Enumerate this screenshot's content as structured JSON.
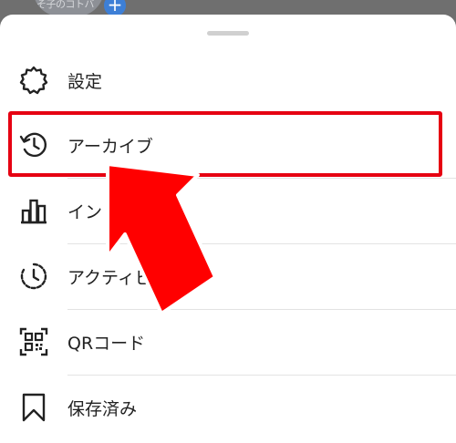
{
  "background": {
    "caption": "そ子のコトバ"
  },
  "menu": {
    "items": [
      {
        "label": "設定",
        "icon": "gear-icon"
      },
      {
        "label": "アーカイブ",
        "icon": "archive-history-icon"
      },
      {
        "label": "イン",
        "icon": "insights-bar-chart-icon"
      },
      {
        "label": "アクティビ",
        "icon": "activity-clock-icon"
      },
      {
        "label": "QRコード",
        "icon": "qr-code-icon"
      },
      {
        "label": "保存済み",
        "icon": "bookmark-icon"
      }
    ]
  },
  "annotation": {
    "highlight_color": "#e60012",
    "arrow_color": "#ff0000",
    "target": "アーカイブ"
  }
}
